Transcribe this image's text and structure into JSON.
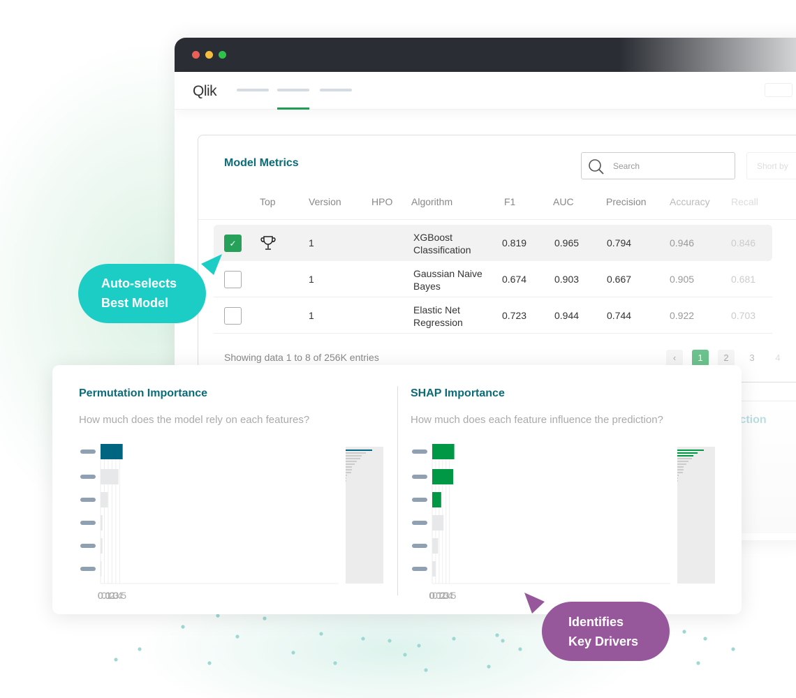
{
  "window": {
    "traffic_lights": [
      "#ec5f57",
      "#f4bd40",
      "#2fc24a"
    ]
  },
  "nav": {
    "logo": "Qlik",
    "active_tab_index": 1,
    "accent": "#1f9d55"
  },
  "metrics": {
    "title": "Model Metrics",
    "search_placeholder": "Search",
    "sort_label": "Short by",
    "columns": [
      "Top",
      "Version",
      "HPO",
      "Algorithm",
      "F1",
      "AUC",
      "Precision",
      "Accuracy",
      "Recall"
    ],
    "rows": [
      {
        "selected": true,
        "top": true,
        "version": "1",
        "hpo": "",
        "algorithm": "XGBoost Classification",
        "f1": "0.819",
        "auc": "0.965",
        "precision": "0.794",
        "accuracy": "0.946",
        "recall": "0.846"
      },
      {
        "selected": false,
        "top": false,
        "version": "1",
        "hpo": "",
        "algorithm": "Gaussian Naive Bayes",
        "f1": "0.674",
        "auc": "0.903",
        "precision": "0.667",
        "accuracy": "0.905",
        "recall": "0.681"
      },
      {
        "selected": false,
        "top": false,
        "version": "1",
        "hpo": "",
        "algorithm": "Elastic Net Regression",
        "f1": "0.723",
        "auc": "0.944",
        "precision": "0.744",
        "accuracy": "0.922",
        "recall": "0.703"
      }
    ],
    "footer": "Showing data 1 to 8 of  256K entries",
    "pagination": {
      "prev": "‹",
      "pages": [
        "1",
        "2",
        "3",
        "4"
      ],
      "current": "1"
    }
  },
  "background_panel_text": "iction",
  "chart_data": [
    {
      "type": "bar",
      "orientation": "horizontal",
      "title": "Permutation Importance",
      "subtitle": "How much does the model rely on each features?",
      "values": [
        0.58,
        0.47,
        0.19,
        0.05,
        0.05,
        0.025
      ],
      "highlight_count": 1,
      "highlight_color": "#006580",
      "base_color": "#e6e8e9",
      "xlim": [
        0,
        0.62
      ],
      "xticks": [
        "0",
        "0.1",
        "0.2",
        "0.3",
        "0.4",
        "0.5"
      ],
      "grid": true
    },
    {
      "type": "bar",
      "orientation": "horizontal",
      "title": "SHAP Importance",
      "subtitle": "How much does each feature influence the prediction?",
      "values": [
        0.64,
        0.61,
        0.26,
        0.33,
        0.17,
        0.1
      ],
      "highlight_count": 3,
      "highlight_color": "#009845",
      "base_color": "#e6e8e9",
      "xlim": [
        0,
        0.7
      ],
      "xticks": [
        "0",
        "0.1",
        "0.2",
        "0.3",
        "0.4",
        "0.5"
      ],
      "grid": true
    }
  ],
  "callouts": {
    "auto_select": {
      "text": [
        "Auto-selects",
        "Best Model"
      ],
      "color": "#1ccdc6"
    },
    "key_drivers": {
      "text": [
        "Identifies",
        "Key Drivers"
      ],
      "color": "#96579b"
    }
  }
}
